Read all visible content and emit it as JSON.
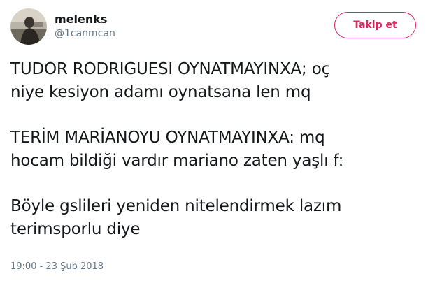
{
  "user": {
    "display_name": "melenks",
    "handle": "@1canmcan",
    "avatar_icon": "user-avatar"
  },
  "follow_button": {
    "label": "Takip et",
    "color": "#e0245e"
  },
  "tweet": {
    "paragraphs": [
      {
        "lines": [
          "TUDOR RODRIGUESI OYNATMAYINXA; oç",
          "niye kesiyon adamı oynatsana len mq"
        ]
      },
      {
        "lines": [
          "TERİM MARİANOYU OYNATMAYINXA: mq",
          "hocam bildiği vardır mariano zaten yaşlı f:"
        ]
      },
      {
        "lines": [
          "Böyle gslileri yeniden nitelendirmek lazım",
          "terimsporlu diye"
        ]
      }
    ],
    "timestamp": "19:00 - 23 Şub 2018"
  }
}
